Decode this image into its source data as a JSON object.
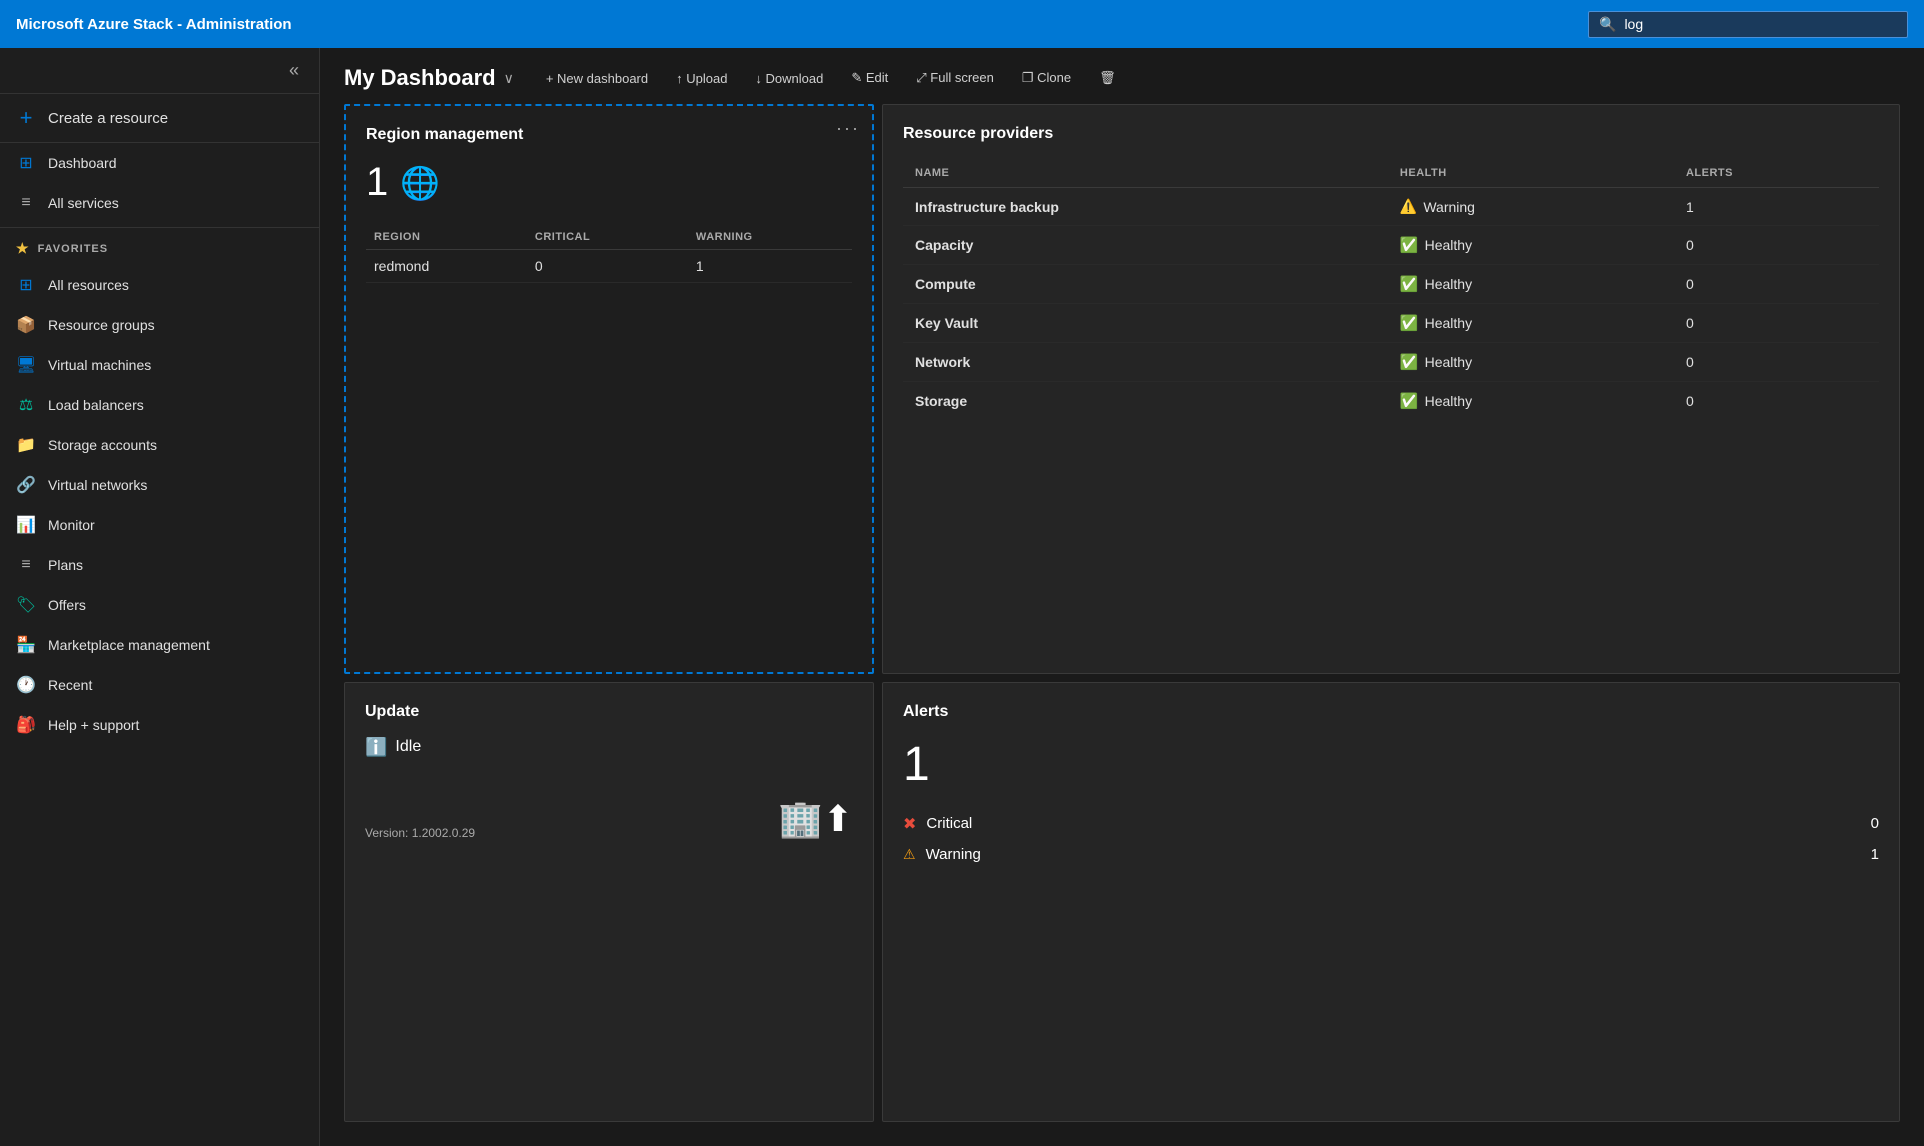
{
  "topbar": {
    "title": "Microsoft Azure Stack - Administration",
    "search_placeholder": "log",
    "search_value": "log"
  },
  "sidebar": {
    "collapse_label": "«",
    "create_resource": "Create a resource",
    "favorites_label": "FAVORITES",
    "items": [
      {
        "id": "dashboard",
        "label": "Dashboard",
        "icon": "🟦"
      },
      {
        "id": "all-services",
        "label": "All services",
        "icon": "≡"
      },
      {
        "id": "all-resources",
        "label": "All resources",
        "icon": "⊞"
      },
      {
        "id": "resource-groups",
        "label": "Resource groups",
        "icon": "📦"
      },
      {
        "id": "virtual-machines",
        "label": "Virtual machines",
        "icon": "🖥"
      },
      {
        "id": "load-balancers",
        "label": "Load balancers",
        "icon": "⚖"
      },
      {
        "id": "storage-accounts",
        "label": "Storage accounts",
        "icon": "📁"
      },
      {
        "id": "virtual-networks",
        "label": "Virtual networks",
        "icon": "🔗"
      },
      {
        "id": "monitor",
        "label": "Monitor",
        "icon": "📊"
      },
      {
        "id": "plans",
        "label": "Plans",
        "icon": "≡"
      },
      {
        "id": "offers",
        "label": "Offers",
        "icon": "🏷"
      },
      {
        "id": "marketplace-management",
        "label": "Marketplace management",
        "icon": "🏪"
      },
      {
        "id": "recent",
        "label": "Recent",
        "icon": "🕐"
      },
      {
        "id": "help-support",
        "label": "Help + support",
        "icon": "🎒"
      }
    ]
  },
  "toolbar": {
    "dashboard_title": "My Dashboard",
    "new_dashboard_label": "+ New dashboard",
    "upload_label": "↑ Upload",
    "download_label": "↓ Download",
    "edit_label": "✎ Edit",
    "fullscreen_label": "⤢ Full screen",
    "clone_label": "❐ Clone",
    "delete_label": "🗑"
  },
  "region_management": {
    "title": "Region management",
    "count": "1",
    "globe_emoji": "🌐",
    "columns": {
      "region": "REGION",
      "critical": "CRITICAL",
      "warning": "WARNING"
    },
    "rows": [
      {
        "region": "redmond",
        "critical": "0",
        "warning": "1"
      }
    ]
  },
  "update": {
    "title": "Update",
    "status": "Idle",
    "version_label": "Version: 1.2002.0.29"
  },
  "alerts": {
    "title": "Alerts",
    "total_count": "1",
    "critical_label": "Critical",
    "critical_count": "0",
    "warning_label": "Warning",
    "warning_count": "1"
  },
  "resource_providers": {
    "title": "Resource providers",
    "columns": {
      "name": "NAME",
      "health": "HEALTH",
      "alerts": "ALERTS"
    },
    "rows": [
      {
        "name": "Infrastructure backup",
        "health": "Warning",
        "health_type": "warning",
        "alerts": "1"
      },
      {
        "name": "Capacity",
        "health": "Healthy",
        "health_type": "healthy",
        "alerts": "0"
      },
      {
        "name": "Compute",
        "health": "Healthy",
        "health_type": "healthy",
        "alerts": "0"
      },
      {
        "name": "Key Vault",
        "health": "Healthy",
        "health_type": "healthy",
        "alerts": "0"
      },
      {
        "name": "Network",
        "health": "Healthy",
        "health_type": "healthy",
        "alerts": "0"
      },
      {
        "name": "Storage",
        "health": "Healthy",
        "health_type": "healthy",
        "alerts": "0"
      }
    ]
  }
}
